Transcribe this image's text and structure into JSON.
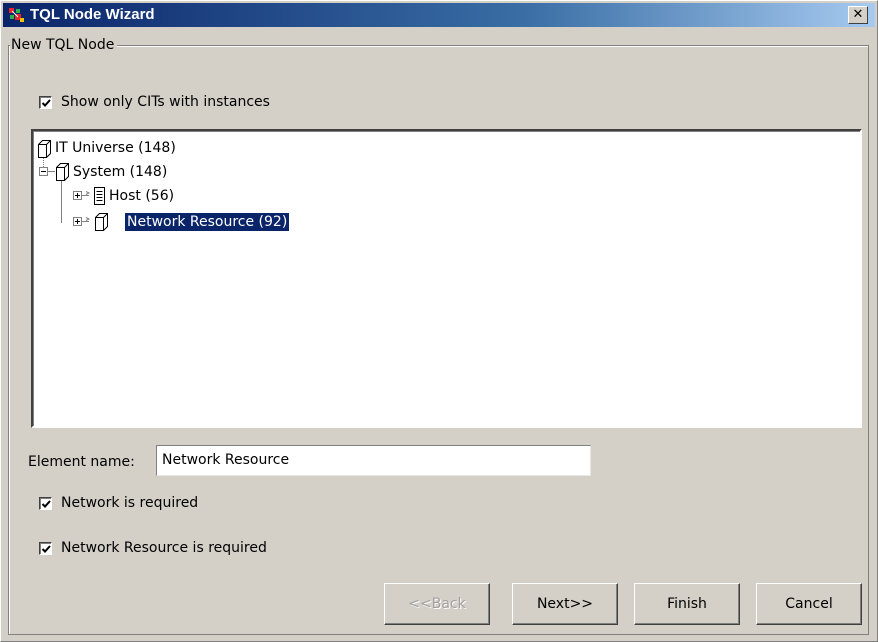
{
  "window": {
    "title": "TQL Node Wizard",
    "close_label": "✕"
  },
  "group": {
    "legend": "New TQL Node"
  },
  "show_only_cits": {
    "label": "Show only CITs with instances",
    "checked": true
  },
  "tree": {
    "items": [
      {
        "label": "IT Universe (148)",
        "level": 0,
        "expander": "none",
        "icon": "box-icon",
        "selected": false
      },
      {
        "label": "System (148)",
        "level": 1,
        "expander": "minus",
        "icon": "box-icon",
        "selected": false
      },
      {
        "label": "Host (56)",
        "level": 2,
        "expander": "plus",
        "icon": "server-icon",
        "selected": false
      },
      {
        "label": "Network Resource (92)",
        "level": 2,
        "expander": "plus",
        "icon": "box-icon",
        "selected": true
      }
    ]
  },
  "element_name": {
    "label": "Element name:",
    "value": "Network Resource"
  },
  "network_required": {
    "label": "Network is required",
    "checked": true
  },
  "network_resource_required": {
    "label": "Network Resource is required",
    "checked": true
  },
  "buttons": {
    "back": "<<Back",
    "next": "Next>>",
    "finish": "Finish",
    "cancel": "Cancel"
  },
  "colors": {
    "titlebar": "#0a246a",
    "selection": "#0a246a",
    "face": "#d4d0c8"
  }
}
